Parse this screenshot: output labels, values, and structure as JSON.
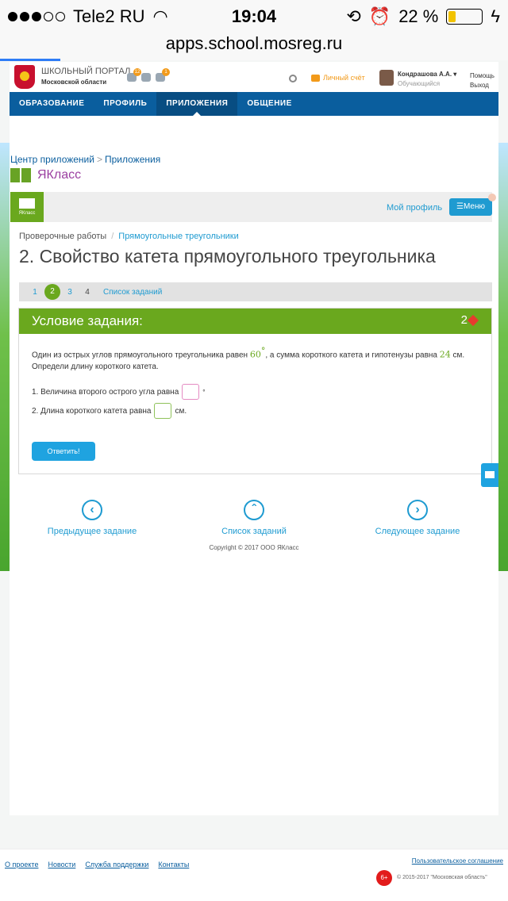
{
  "statusbar": {
    "carrier": "Tele2 RU",
    "time": "19:04",
    "battery": "22 %",
    "battery_level": 0.22
  },
  "browser": {
    "url": "apps.school.mosreg.ru"
  },
  "portal": {
    "title": "ШКОЛЬНЫЙ ПОРТАЛ",
    "region": "Московской области",
    "badge_messages": "12",
    "badge_notifications": "1",
    "wallet": "Личный счёт",
    "user_name": "Кондрашова А.А. ▾",
    "user_role": "Обучающийся",
    "help": "Помощь",
    "logout": "Выход",
    "nav": [
      "ОБРАЗОВАНИЕ",
      "ПРОФИЛЬ",
      "ПРИЛОЖЕНИЯ",
      "ОБЩЕНИЕ"
    ],
    "breadcrumb": [
      "Центр приложений",
      "Приложения"
    ],
    "breadcrumb_sep": ">",
    "app_name": "ЯКласс"
  },
  "yaklass": {
    "logo_label": "ЯКласс",
    "my_profile": "Мой профиль",
    "menu": "☰Меню",
    "crumbs": [
      "Проверочные работы",
      "Прямоугольные треугольники"
    ],
    "crumb_sep": "/",
    "heading": "2. Свойство катета прямоугольного треугольника",
    "pager": [
      "1",
      "2",
      "3",
      "4"
    ],
    "pager_list": "Список заданий",
    "task_title": "Условие задания:",
    "task_points": "2",
    "condition_part1": "Один из острых углов прямоугольного треугольника равен",
    "angle": "60",
    "degree": "°",
    "condition_part2": ", а сумма короткого катета и гипотенузы равна",
    "sum": "24",
    "unit_cm": "см.",
    "condition_line2": "Определи длину короткого катета.",
    "q1": "1. Величина второго острого угла равна",
    "q2": "2. Длина короткого катета равна",
    "q2_unit": "см.",
    "answer_button": "Ответить!",
    "prev": "Предыдущее задание",
    "list": "Список заданий",
    "next": "Следующее задание",
    "copyright": "Copyright © 2017 ООО ЯКласс"
  },
  "footer": {
    "links": [
      "О проекте",
      "Новости",
      "Служба поддержки",
      "Контакты"
    ],
    "agreement": "Пользовательское соглашение",
    "age": "6+",
    "copyright": "© 2015-2017 \"Московская область\""
  }
}
